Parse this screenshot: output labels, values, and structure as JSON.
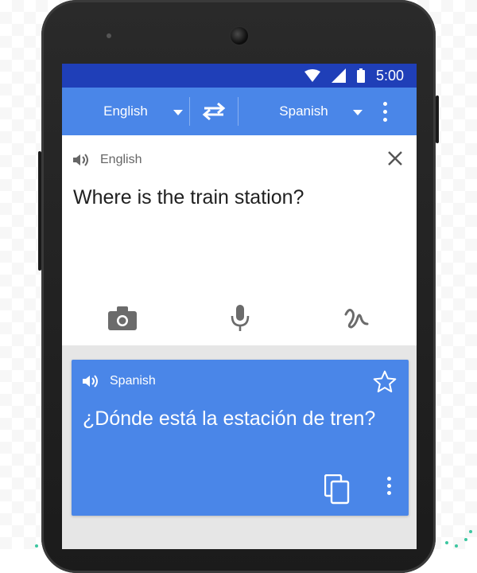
{
  "status_bar": {
    "time": "5:00"
  },
  "toolbar": {
    "source_language": "English",
    "target_language": "Spanish"
  },
  "input": {
    "language_label": "English",
    "text": "Where is the train station?"
  },
  "result": {
    "language_label": "Spanish",
    "text": "¿Dónde está la estación de tren?"
  },
  "colors": {
    "status_bar": "#1f3fb8",
    "toolbar": "#4a86e8",
    "result_card": "#4a86e8"
  },
  "icons": [
    "wifi-icon",
    "signal-icon",
    "battery-icon",
    "swap-icon",
    "more-icon",
    "speaker-icon",
    "close-icon",
    "camera-icon",
    "microphone-icon",
    "handwriting-icon",
    "star-icon",
    "copy-icon"
  ]
}
